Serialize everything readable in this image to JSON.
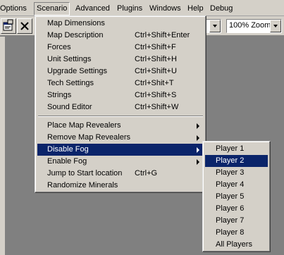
{
  "menubar": {
    "items": [
      "Options",
      "Scenario",
      "Advanced",
      "Plugins",
      "Windows",
      "Help",
      "Debug"
    ]
  },
  "toolbar": {
    "layer_value": "",
    "zoom_value": "100% Zoom"
  },
  "scenario_menu": {
    "items": [
      {
        "label": "Map Dimensions",
        "shortcut": ""
      },
      {
        "label": "Map Description",
        "shortcut": "Ctrl+Shift+Enter"
      },
      {
        "label": "Forces",
        "shortcut": "Ctrl+Shift+F"
      },
      {
        "label": "Unit Settings",
        "shortcut": "Ctrl+Shift+H"
      },
      {
        "label": "Upgrade Settings",
        "shortcut": "Ctrl+Shift+U"
      },
      {
        "label": "Tech Settings",
        "shortcut": "Ctrl+Shit+T"
      },
      {
        "label": "Strings",
        "shortcut": "Ctrl+Shift+S"
      },
      {
        "label": "Sound Editor",
        "shortcut": "Ctrl+Shift+W"
      },
      {
        "label": "Place Map Revealers",
        "shortcut": ""
      },
      {
        "label": "Remove Map Revealers",
        "shortcut": ""
      },
      {
        "label": "Disable Fog",
        "shortcut": ""
      },
      {
        "label": "Enable Fog",
        "shortcut": ""
      },
      {
        "label": "Jump to Start location",
        "shortcut": "Ctrl+G"
      },
      {
        "label": "Randomize Minerals",
        "shortcut": ""
      }
    ]
  },
  "player_submenu": {
    "items": [
      "Player 1",
      "Player 2",
      "Player 3",
      "Player 4",
      "Player 5",
      "Player 6",
      "Player 7",
      "Player 8",
      "All Players"
    ]
  },
  "colors": {
    "highlight": "#0a246a",
    "face": "#d4d0c8",
    "workspace": "#808080"
  }
}
